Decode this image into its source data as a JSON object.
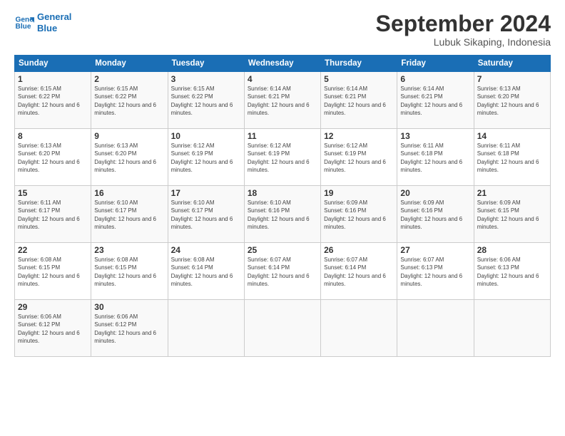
{
  "header": {
    "logo_line1": "General",
    "logo_line2": "Blue",
    "month_title": "September 2024",
    "location": "Lubuk Sikaping, Indonesia"
  },
  "weekdays": [
    "Sunday",
    "Monday",
    "Tuesday",
    "Wednesday",
    "Thursday",
    "Friday",
    "Saturday"
  ],
  "weeks": [
    [
      {
        "day": "1",
        "rise": "6:15 AM",
        "set": "6:22 PM",
        "daylight": "12 hours and 6 minutes."
      },
      {
        "day": "2",
        "rise": "6:15 AM",
        "set": "6:22 PM",
        "daylight": "12 hours and 6 minutes."
      },
      {
        "day": "3",
        "rise": "6:15 AM",
        "set": "6:22 PM",
        "daylight": "12 hours and 6 minutes."
      },
      {
        "day": "4",
        "rise": "6:14 AM",
        "set": "6:21 PM",
        "daylight": "12 hours and 6 minutes."
      },
      {
        "day": "5",
        "rise": "6:14 AM",
        "set": "6:21 PM",
        "daylight": "12 hours and 6 minutes."
      },
      {
        "day": "6",
        "rise": "6:14 AM",
        "set": "6:21 PM",
        "daylight": "12 hours and 6 minutes."
      },
      {
        "day": "7",
        "rise": "6:13 AM",
        "set": "6:20 PM",
        "daylight": "12 hours and 6 minutes."
      }
    ],
    [
      {
        "day": "8",
        "rise": "6:13 AM",
        "set": "6:20 PM",
        "daylight": "12 hours and 6 minutes."
      },
      {
        "day": "9",
        "rise": "6:13 AM",
        "set": "6:20 PM",
        "daylight": "12 hours and 6 minutes."
      },
      {
        "day": "10",
        "rise": "6:12 AM",
        "set": "6:19 PM",
        "daylight": "12 hours and 6 minutes."
      },
      {
        "day": "11",
        "rise": "6:12 AM",
        "set": "6:19 PM",
        "daylight": "12 hours and 6 minutes."
      },
      {
        "day": "12",
        "rise": "6:12 AM",
        "set": "6:19 PM",
        "daylight": "12 hours and 6 minutes."
      },
      {
        "day": "13",
        "rise": "6:11 AM",
        "set": "6:18 PM",
        "daylight": "12 hours and 6 minutes."
      },
      {
        "day": "14",
        "rise": "6:11 AM",
        "set": "6:18 PM",
        "daylight": "12 hours and 6 minutes."
      }
    ],
    [
      {
        "day": "15",
        "rise": "6:11 AM",
        "set": "6:17 PM",
        "daylight": "12 hours and 6 minutes."
      },
      {
        "day": "16",
        "rise": "6:10 AM",
        "set": "6:17 PM",
        "daylight": "12 hours and 6 minutes."
      },
      {
        "day": "17",
        "rise": "6:10 AM",
        "set": "6:17 PM",
        "daylight": "12 hours and 6 minutes."
      },
      {
        "day": "18",
        "rise": "6:10 AM",
        "set": "6:16 PM",
        "daylight": "12 hours and 6 minutes."
      },
      {
        "day": "19",
        "rise": "6:09 AM",
        "set": "6:16 PM",
        "daylight": "12 hours and 6 minutes."
      },
      {
        "day": "20",
        "rise": "6:09 AM",
        "set": "6:16 PM",
        "daylight": "12 hours and 6 minutes."
      },
      {
        "day": "21",
        "rise": "6:09 AM",
        "set": "6:15 PM",
        "daylight": "12 hours and 6 minutes."
      }
    ],
    [
      {
        "day": "22",
        "rise": "6:08 AM",
        "set": "6:15 PM",
        "daylight": "12 hours and 6 minutes."
      },
      {
        "day": "23",
        "rise": "6:08 AM",
        "set": "6:15 PM",
        "daylight": "12 hours and 6 minutes."
      },
      {
        "day": "24",
        "rise": "6:08 AM",
        "set": "6:14 PM",
        "daylight": "12 hours and 6 minutes."
      },
      {
        "day": "25",
        "rise": "6:07 AM",
        "set": "6:14 PM",
        "daylight": "12 hours and 6 minutes."
      },
      {
        "day": "26",
        "rise": "6:07 AM",
        "set": "6:14 PM",
        "daylight": "12 hours and 6 minutes."
      },
      {
        "day": "27",
        "rise": "6:07 AM",
        "set": "6:13 PM",
        "daylight": "12 hours and 6 minutes."
      },
      {
        "day": "28",
        "rise": "6:06 AM",
        "set": "6:13 PM",
        "daylight": "12 hours and 6 minutes."
      }
    ],
    [
      {
        "day": "29",
        "rise": "6:06 AM",
        "set": "6:12 PM",
        "daylight": "12 hours and 6 minutes."
      },
      {
        "day": "30",
        "rise": "6:06 AM",
        "set": "6:12 PM",
        "daylight": "12 hours and 6 minutes."
      },
      null,
      null,
      null,
      null,
      null
    ]
  ]
}
